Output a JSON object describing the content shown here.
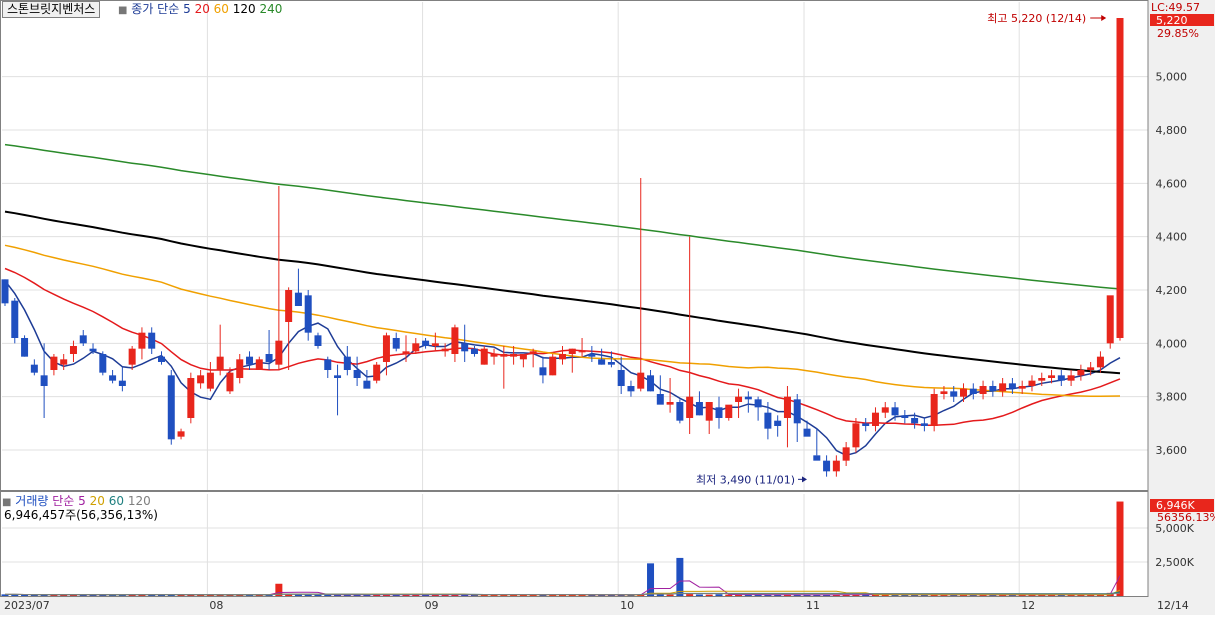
{
  "header": {
    "stock_name": "스톤브릿지벤처스",
    "price_legend_prefix": "종가 단순",
    "ma_periods": [
      "5",
      "20",
      "60",
      "120",
      "240"
    ],
    "ma_colors": [
      "#1e3c96",
      "#e41a1c",
      "#f0a000",
      "#000000",
      "#2a8a2a"
    ],
    "lc_label": "LC:49.57",
    "last_price_tag": "5,220",
    "change_pct_tag": "29.85%"
  },
  "volume_header": {
    "label": "거래량",
    "legend_prefix": "단순",
    "ma_periods": [
      "5",
      "20",
      "60",
      "120"
    ],
    "ma_colors": [
      "#a020a0",
      "#d0a000",
      "#208080",
      "#7f7f7f"
    ],
    "summary": "6,946,457주(56,356,13%)",
    "last_volume_tag": "6,946K",
    "volume_ratio_tag": "56356.13%"
  },
  "colors": {
    "up": "#e8261c",
    "down": "#1f4fc0",
    "grid": "#e0e0e0",
    "axis_bg": "#f0f0f0",
    "tag_bg": "#e8261c"
  },
  "chart_data": [
    {
      "type": "candlestick",
      "title": "",
      "yaxis_side": "right",
      "ylim": [
        3450,
        5280
      ],
      "yticks": [
        3600,
        3800,
        4000,
        4200,
        4400,
        4600,
        4800,
        5000
      ],
      "ytick_labels": [
        "3,600",
        "3,800",
        "4,000",
        "4,200",
        "4,400",
        "4,600",
        "4,800",
        "5,000"
      ],
      "xaxis_labels": [
        {
          "label": "2023/07",
          "index": 0
        },
        {
          "label": "08",
          "index": 21
        },
        {
          "label": "09",
          "index": 43
        },
        {
          "label": "10",
          "index": 63
        },
        {
          "label": "11",
          "index": 82
        },
        {
          "label": "12",
          "index": 104
        },
        {
          "label": "12/14",
          "index": 114
        }
      ],
      "annotations": {
        "high": {
          "text": "최고 5,220 (12/14)",
          "index": 113,
          "value": 5220
        },
        "low": {
          "text": "최저 3,490 (11/01)",
          "index": 82,
          "value": 3490
        }
      },
      "candles": [
        [
          4240,
          4240,
          4140,
          4150
        ],
        [
          4160,
          4170,
          4000,
          4020
        ],
        [
          4020,
          4030,
          3950,
          3950
        ],
        [
          3920,
          3940,
          3880,
          3890
        ],
        [
          3880,
          4000,
          3720,
          3840
        ],
        [
          3900,
          3960,
          3880,
          3950
        ],
        [
          3920,
          3960,
          3900,
          3940
        ],
        [
          3960,
          4010,
          3930,
          3990
        ],
        [
          4030,
          4050,
          3990,
          4000
        ],
        [
          3980,
          4000,
          3960,
          3970
        ],
        [
          3960,
          3970,
          3880,
          3890
        ],
        [
          3880,
          3900,
          3850,
          3860
        ],
        [
          3860,
          3910,
          3820,
          3840
        ],
        [
          3920,
          3990,
          3900,
          3980
        ],
        [
          3980,
          4060,
          3940,
          4040
        ],
        [
          4040,
          4060,
          3960,
          3980
        ],
        [
          3950,
          3970,
          3920,
          3930
        ],
        [
          3880,
          3900,
          3620,
          3640
        ],
        [
          3650,
          3680,
          3640,
          3670
        ],
        [
          3720,
          3890,
          3700,
          3870
        ],
        [
          3850,
          3900,
          3830,
          3880
        ],
        [
          3830,
          3930,
          3820,
          3890
        ],
        [
          3900,
          4070,
          3880,
          3950
        ],
        [
          3820,
          3910,
          3810,
          3890
        ],
        [
          3870,
          3960,
          3850,
          3940
        ],
        [
          3950,
          3970,
          3900,
          3920
        ],
        [
          3900,
          3950,
          3900,
          3940
        ],
        [
          3960,
          4050,
          3900,
          3930
        ],
        [
          3920,
          4590,
          3900,
          4010
        ],
        [
          4080,
          4210,
          3900,
          4200
        ],
        [
          4190,
          4280,
          4140,
          4140
        ],
        [
          4180,
          4200,
          4010,
          4040
        ],
        [
          4030,
          4040,
          3980,
          3990
        ],
        [
          3940,
          3950,
          3870,
          3900
        ],
        [
          3880,
          3920,
          3730,
          3870
        ],
        [
          3950,
          3990,
          3880,
          3900
        ],
        [
          3900,
          3950,
          3840,
          3870
        ],
        [
          3860,
          3900,
          3840,
          3830
        ],
        [
          3860,
          3930,
          3850,
          3920
        ],
        [
          3930,
          4040,
          3880,
          4030
        ],
        [
          4020,
          4040,
          3970,
          3980
        ],
        [
          3960,
          4030,
          3930,
          3970
        ],
        [
          3970,
          4020,
          3960,
          4000
        ],
        [
          4010,
          4020,
          3980,
          3990
        ],
        [
          3990,
          4040,
          3970,
          4000
        ],
        [
          3970,
          4000,
          3950,
          3980
        ],
        [
          3960,
          4070,
          3930,
          4060
        ],
        [
          4000,
          4070,
          3930,
          3970
        ],
        [
          3980,
          3990,
          3950,
          3960
        ],
        [
          3920,
          3990,
          3920,
          3980
        ],
        [
          3950,
          3980,
          3920,
          3960
        ],
        [
          3950,
          3990,
          3830,
          3960
        ],
        [
          3950,
          3990,
          3920,
          3960
        ],
        [
          3940,
          3960,
          3910,
          3960
        ],
        [
          3960,
          3980,
          3910,
          3970
        ],
        [
          3910,
          3950,
          3850,
          3880
        ],
        [
          3880,
          3960,
          3880,
          3950
        ],
        [
          3940,
          3990,
          3920,
          3960
        ],
        [
          3960,
          3980,
          3890,
          3980
        ],
        [
          3970,
          4020,
          3950,
          3970
        ],
        [
          3960,
          3990,
          3930,
          3950
        ],
        [
          3940,
          3980,
          3920,
          3920
        ],
        [
          3930,
          3970,
          3910,
          3920
        ],
        [
          3900,
          3950,
          3810,
          3840
        ],
        [
          3840,
          3860,
          3800,
          3820
        ],
        [
          3830,
          4620,
          3820,
          3890
        ],
        [
          3880,
          3900,
          3820,
          3820
        ],
        [
          3810,
          3880,
          3810,
          3770
        ],
        [
          3770,
          3870,
          3740,
          3780
        ],
        [
          3780,
          3790,
          3700,
          3710
        ],
        [
          3720,
          4400,
          3660,
          3800
        ],
        [
          3780,
          3820,
          3730,
          3730
        ],
        [
          3710,
          3770,
          3660,
          3780
        ],
        [
          3760,
          3800,
          3680,
          3720
        ],
        [
          3720,
          3760,
          3710,
          3770
        ],
        [
          3780,
          3830,
          3720,
          3800
        ],
        [
          3800,
          3820,
          3740,
          3790
        ],
        [
          3790,
          3800,
          3710,
          3760
        ],
        [
          3740,
          3780,
          3640,
          3680
        ],
        [
          3710,
          3730,
          3650,
          3690
        ],
        [
          3720,
          3840,
          3610,
          3800
        ],
        [
          3790,
          3810,
          3630,
          3700
        ],
        [
          3680,
          3710,
          3660,
          3650
        ],
        [
          3580,
          3680,
          3580,
          3560
        ]
      ],
      "ma_series": [
        {
          "name": "5",
          "color": "#1e3c96"
        },
        {
          "name": "20",
          "color": "#e41a1c"
        },
        {
          "name": "60",
          "color": "#f0a000"
        },
        {
          "name": "120",
          "color": "#000000"
        },
        {
          "name": "240",
          "color": "#2a8a2a"
        }
      ]
    },
    {
      "type": "bar",
      "title": "",
      "yaxis_side": "right",
      "ylim": [
        0,
        7500
      ],
      "yticks": [
        2500,
        5000
      ],
      "ytick_labels": [
        "2,500K",
        "5,000K"
      ],
      "unit": "K",
      "values": [
        120,
        110,
        100,
        90,
        90,
        100,
        100,
        110,
        90,
        90,
        100,
        90,
        90,
        110,
        120,
        110,
        90,
        110,
        90,
        90,
        100,
        90,
        90,
        100,
        100,
        90,
        100,
        100,
        900,
        140,
        110,
        100,
        90,
        100,
        90,
        90,
        100,
        90,
        90,
        110,
        100,
        100,
        90,
        90,
        90,
        80,
        90,
        90,
        90,
        80,
        90,
        80,
        90,
        90,
        80,
        90,
        80,
        90,
        90,
        80,
        80,
        80,
        80,
        80,
        80,
        80,
        2400,
        110,
        100,
        2800,
        140,
        110,
        100,
        130,
        100,
        90,
        100,
        90,
        90,
        90,
        80,
        80,
        80,
        80,
        80,
        90,
        110,
        80,
        130,
        100,
        120,
        100,
        80,
        80,
        90,
        80,
        80,
        80,
        80,
        80,
        80,
        80,
        80,
        80,
        90,
        80,
        80,
        80,
        100,
        100,
        110,
        90,
        100,
        230,
        6946
      ]
    }
  ]
}
